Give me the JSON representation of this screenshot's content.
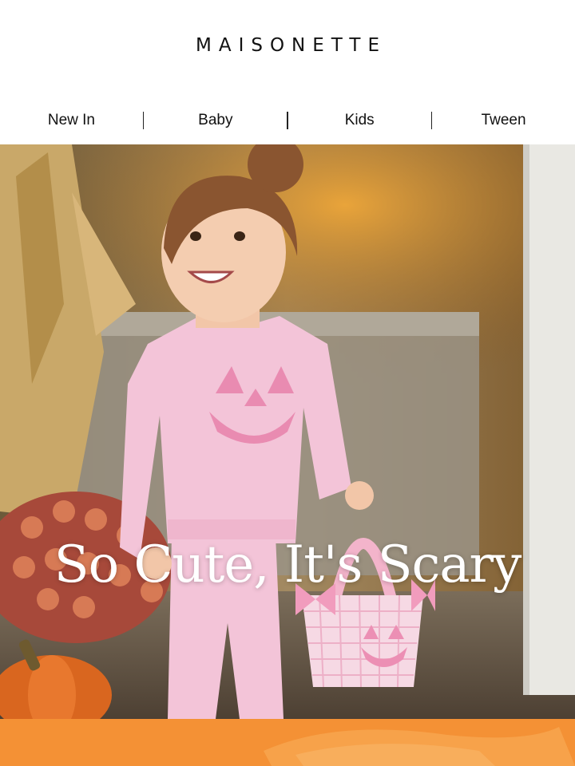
{
  "brand": {
    "logo_text": "MAISONETTE"
  },
  "nav": {
    "items": [
      {
        "label": "New In"
      },
      {
        "label": "Baby"
      },
      {
        "label": "Kids"
      },
      {
        "label": "Tween"
      }
    ]
  },
  "hero": {
    "headline": "So Cute, It's Scary",
    "image_icon": "photo-icon"
  },
  "colors": {
    "text": "#111111",
    "headline": "#ffffff",
    "band": "#f49135",
    "sweater": "#f3c4d8"
  }
}
